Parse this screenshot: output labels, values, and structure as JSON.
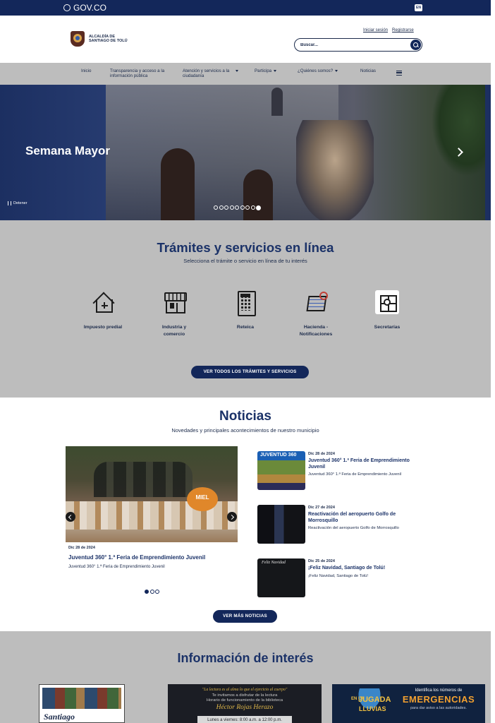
{
  "gov_bar": {
    "brand": "GOV.CO",
    "lang": "EN"
  },
  "header": {
    "logo_text": "ALCALDÍA DE SANTIAGO DE TOLÚ",
    "login_link": "Iniciar sesión",
    "register_link": "Registrarse",
    "search_placeholder": "Buscar..."
  },
  "nav": {
    "items": [
      {
        "label": "Inicio"
      },
      {
        "label": "Transparencia y acceso a la información pública"
      },
      {
        "label": "Atención y servicios a la ciudadanía"
      },
      {
        "label": "Participa"
      },
      {
        "label": "¿Quiénes somos?"
      },
      {
        "label": "Noticias"
      }
    ]
  },
  "hero": {
    "title": "Semana Mayor",
    "pause_label": "Detener",
    "slide_count": 9,
    "active_slide": 9
  },
  "tramites": {
    "title": "Trámites y servicios en línea",
    "subtitle": "Selecciona el trámite o servicio en línea de tu interés",
    "items": [
      {
        "label": "Impuesto predial",
        "icon": "house-icon"
      },
      {
        "label": "Industria y comercio",
        "icon": "store-icon"
      },
      {
        "label": "Reteica",
        "icon": "calculator-icon"
      },
      {
        "label": "Hacienda - Notificaciones",
        "icon": "documents-icon"
      },
      {
        "label": "Secretarías",
        "icon": "puzzle-icon"
      }
    ],
    "button": "VER TODOS LOS TRÁMITES Y SERVICIOS"
  },
  "noticias": {
    "title": "Noticias",
    "subtitle": "Novedades y principales acontecimientos de nuestro municipio",
    "featured": {
      "sign_text": "MIEL",
      "date": "Dic 28 de 2024",
      "title": "Juventud 360° 1.ª Feria de Emprendimiento Juvenil",
      "desc": "Juventud 360° 1.ª Feria de Emprendimiento Juvenil"
    },
    "featured_dots": 3,
    "list": [
      {
        "thumb_label": "JUVENTUD 360",
        "date": "Dic 28 de 2024",
        "title": "Juventud 360° 1.ª Feria de Emprendimiento Juvenil",
        "desc": "Juventud 360° 1.ª Feria de Emprendimiento Juvenil"
      },
      {
        "thumb_label": "",
        "date": "Dic 27 de 2024",
        "title": "Reactivación del aeropuerto Golfo de Morrosquillo",
        "desc": "Reactivación del aeropuerto Golfo de Morrosquillo"
      },
      {
        "thumb_label": "Feliz Navidad",
        "date": "Dic 25 de 2024",
        "title": "¡Feliz Navidad, Santiago de Tolú!",
        "desc": "¡Feliz Navidad, Santiago de Tolú!"
      }
    ],
    "button": "VER MÁS NOTICIAS"
  },
  "info": {
    "title": "Información de interés",
    "card1_caption": "Santiago",
    "card2": {
      "line1": "\"La lectura es al alma lo que el ejercicio al cuerpo\"",
      "line2": "Te invitamos a disfrutar de la lectura",
      "line3": "Horario de funcionamiento de la biblioteca",
      "line4": "Héctor Rojas Herazo",
      "line5": "Lunes a viernes: 8:00 a.m. a 12:00 p.m."
    },
    "card3": {
      "en_la": "EN LA",
      "jugada": "JUGADA",
      "lluvias": "LLUVIAS",
      "right1": "Identifica los números de",
      "right2": "EMERGENCIAS",
      "right3": "para dar aviso a las autoridades."
    }
  }
}
